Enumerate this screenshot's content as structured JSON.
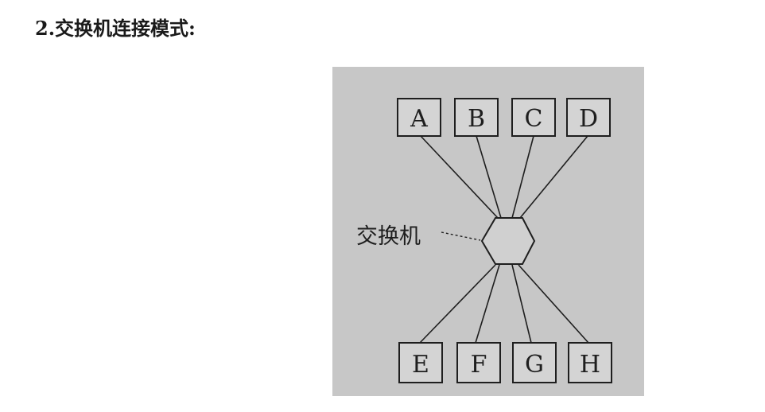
{
  "heading": "2.交换机连接模式:",
  "diagram": {
    "hub_label": "交换机",
    "top_nodes": [
      "A",
      "B",
      "C",
      "D"
    ],
    "bottom_nodes": [
      "E",
      "F",
      "G",
      "H"
    ],
    "colors": {
      "figure_background": "#c7c7c7",
      "line": "#1e1e1e"
    }
  }
}
